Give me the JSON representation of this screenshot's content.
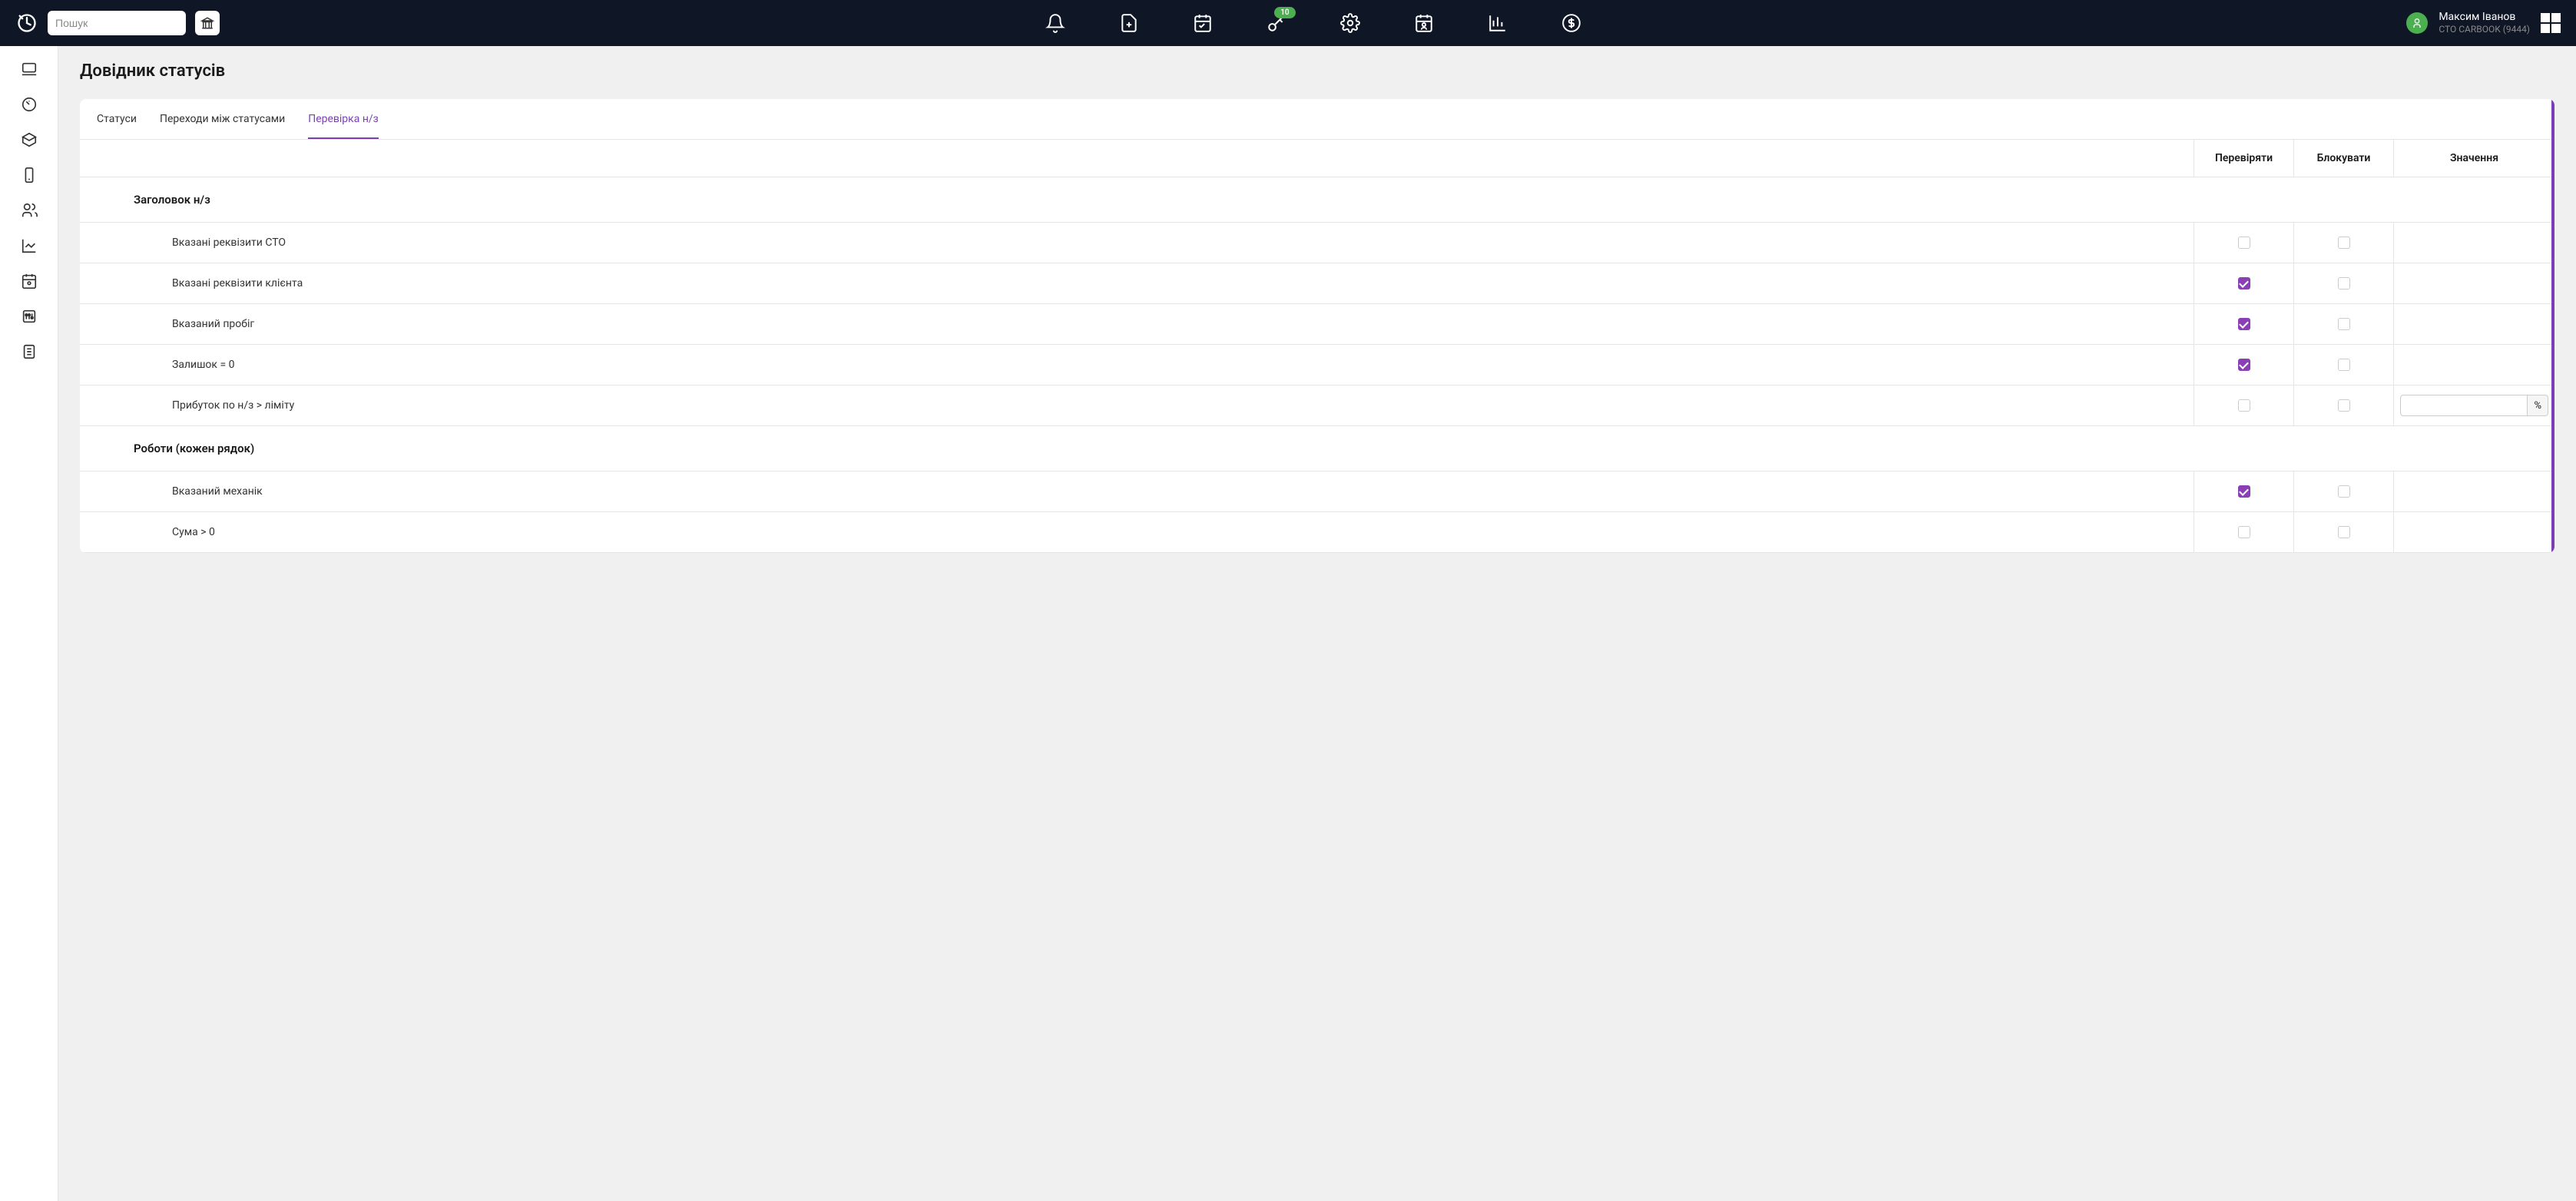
{
  "header": {
    "search_placeholder": "Пошук",
    "key_badge": "10",
    "user_name": "Максим Іванов",
    "user_org": "СТО CARBOOK (9444)"
  },
  "page": {
    "title": "Довідник статусів"
  },
  "tabs": [
    {
      "label": "Статуси",
      "active": false
    },
    {
      "label": "Переходи між статусами",
      "active": false
    },
    {
      "label": "Перевірка н/з",
      "active": true
    }
  ],
  "columns": {
    "check": "Перевіряти",
    "block": "Блокувати",
    "value": "Значення"
  },
  "sections": [
    {
      "title": "Заголовок н/з",
      "rows": [
        {
          "label": "Вказані реквізити СТО",
          "check": false,
          "block": false,
          "has_value": false
        },
        {
          "label": "Вказані реквізити клієнта",
          "check": true,
          "block": false,
          "has_value": false
        },
        {
          "label": "Вказаний пробіг",
          "check": true,
          "block": false,
          "has_value": false
        },
        {
          "label": "Залишок = 0",
          "check": true,
          "block": false,
          "has_value": false
        },
        {
          "label": "Прибуток по н/з > ліміту",
          "check": false,
          "block": false,
          "has_value": true,
          "value": "",
          "suffix": "%"
        }
      ]
    },
    {
      "title": "Роботи (кожен рядок)",
      "rows": [
        {
          "label": "Вказаний механік",
          "check": true,
          "block": false,
          "has_value": false
        },
        {
          "label": "Сума > 0",
          "check": false,
          "block": false,
          "has_value": false
        }
      ]
    }
  ]
}
